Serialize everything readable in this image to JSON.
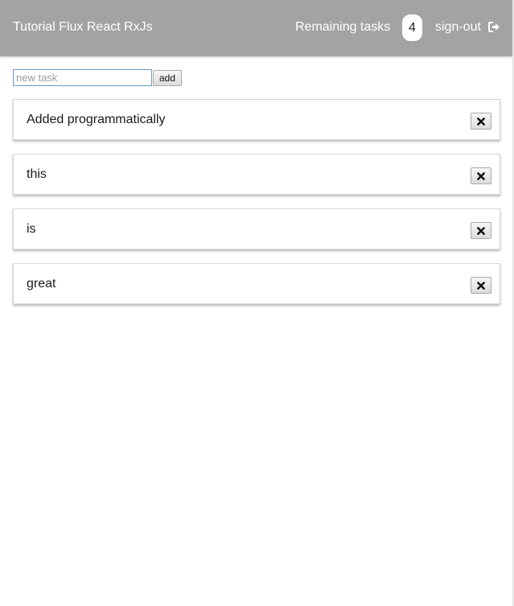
{
  "header": {
    "title": "Tutorial Flux React RxJs",
    "remaining_label": "Remaining tasks",
    "remaining_count": "4",
    "signout_label": "sign-out",
    "signout_icon": "sign-out-icon",
    "background_color": "#a3a3a3"
  },
  "new_task": {
    "value": "",
    "placeholder": "new task",
    "add_label": "add"
  },
  "tasks": [
    {
      "label": "Added programmatically",
      "delete_icon": "close-icon"
    },
    {
      "label": "this",
      "delete_icon": "close-icon"
    },
    {
      "label": "is",
      "delete_icon": "close-icon"
    },
    {
      "label": "great",
      "delete_icon": "close-icon"
    }
  ]
}
